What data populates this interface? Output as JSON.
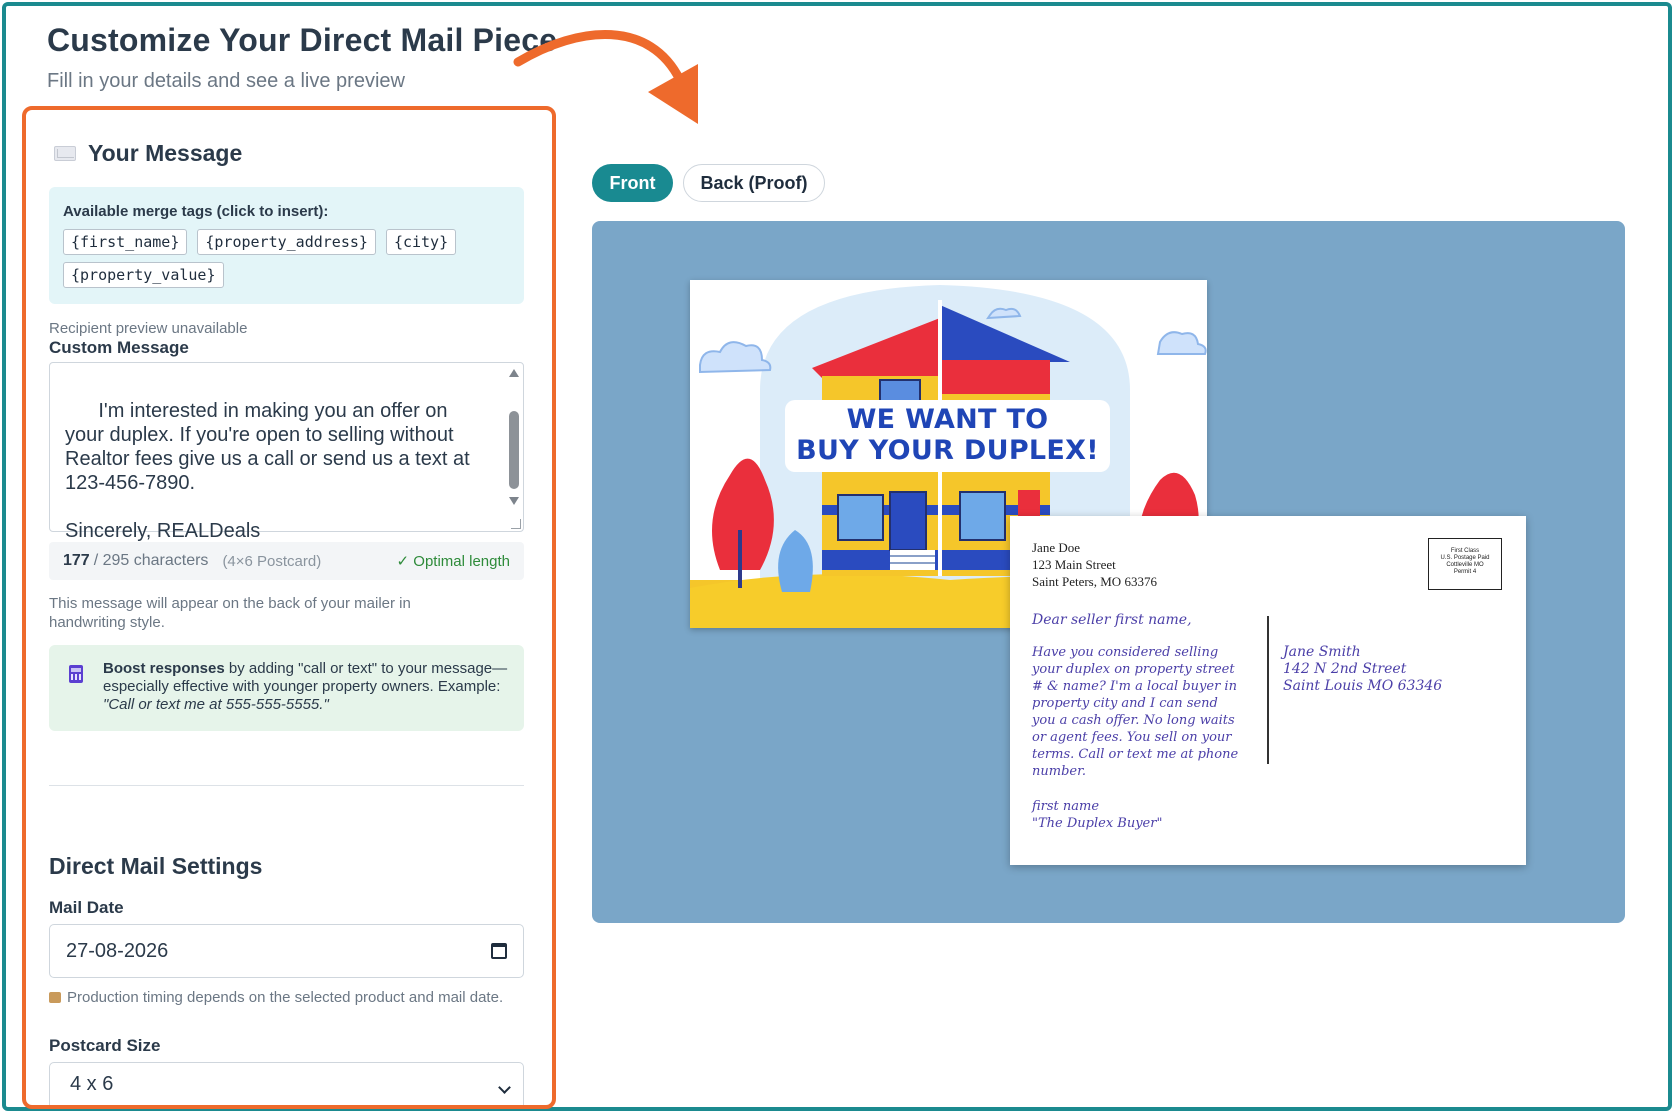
{
  "header": {
    "title": "Customize Your Direct Mail Piece",
    "subtitle": "Fill in your details and see a live preview"
  },
  "message_section": {
    "title": "Your Message",
    "merge_tags_label": "Available merge tags (click to insert):",
    "merge_tags": [
      "{first_name}",
      "{property_address}",
      "{city}",
      "{property_value}"
    ],
    "recipient_note": "Recipient preview unavailable",
    "custom_message_label": "Custom Message",
    "custom_message": "I'm interested in making you an offer on your duplex. If you're open to selling without Realtor fees give us a call or send us a text at 123-456-7890.\n\nSincerely, REALDeals",
    "char_count": "177",
    "char_limit": "/ 295 characters",
    "postcard_format": "(4×6 Postcard)",
    "length_status": "✓ Optimal length",
    "handwriting_note": "This message will appear on the back of your mailer in handwriting style.",
    "boost_bold": "Boost responses",
    "boost_text": " by adding \"call or text\" to your message—especially effective with younger property owners. Example: ",
    "boost_example": "\"Call or text me at 555-555-5555.\""
  },
  "settings_section": {
    "title": "Direct Mail Settings",
    "mail_date_label": "Mail Date",
    "mail_date_value": "27-08-2026",
    "timing_note": "Production timing depends on the selected product and mail date.",
    "postcard_size_label": "Postcard Size",
    "postcard_size_value": "4 x 6"
  },
  "preview": {
    "tabs": [
      {
        "label": "Front",
        "active": true
      },
      {
        "label": "Back (Proof)",
        "active": false
      }
    ],
    "front_headline_line1": "WE WANT TO",
    "front_headline_line2": "BUY YOUR DUPLEX!",
    "back": {
      "return_name": "Jane Doe",
      "return_street": "123 Main Street",
      "return_city": "Saint Peters, MO 63376",
      "stamp_lines": [
        "First Class",
        "U.S. Postage Paid",
        "Cottleville MO",
        "Permit 4"
      ],
      "greeting": "Dear seller first name,",
      "body": "Have you considered selling your duplex on property street # & name? I'm a local buyer in property city and I can send you a cash offer. No long waits or agent fees. You sell on your terms. Call or text me at phone number.",
      "sign_name": "first name",
      "sign_title": "\"The Duplex Buyer\"",
      "recipient_name": "Jane Smith",
      "recipient_street": "142 N 2nd Street",
      "recipient_city": "Saint Louis MO 63346"
    }
  },
  "colors": {
    "frame": "#1b8a8f",
    "panel_border": "#ee6a2c",
    "tab_active": "#198a91",
    "stage_bg": "#7aa6c8",
    "headline": "#1f45b6",
    "handwriting": "#4b3fa8"
  }
}
